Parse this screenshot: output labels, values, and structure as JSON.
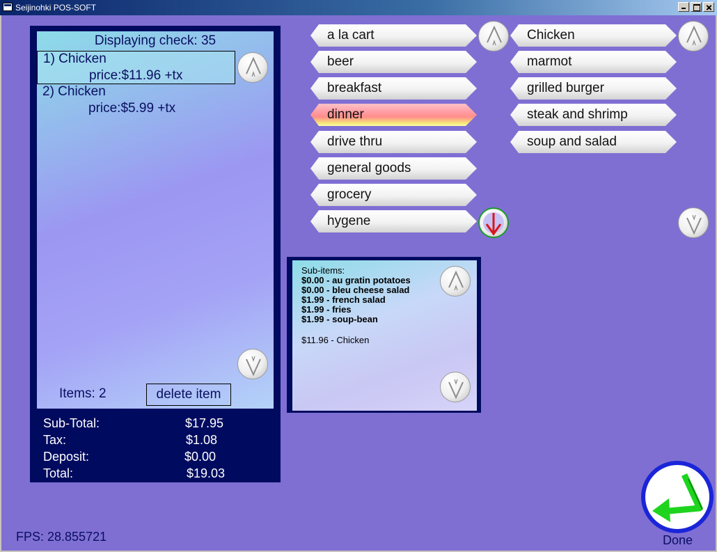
{
  "window": {
    "title": "Seijinohki POS-SOFT"
  },
  "check": {
    "title": "Displaying check: 35",
    "items": [
      {
        "name": "1) Chicken",
        "price": "price:$11.96 +tx"
      },
      {
        "name": "2) Chicken",
        "price": "price:$5.99 +tx"
      }
    ],
    "items_count": "Items: 2",
    "delete_label": "delete item"
  },
  "totals": {
    "subtotal_label": "Sub-Total:",
    "subtotal_value": "$17.95",
    "tax_label": "Tax:",
    "tax_value": "$1.08",
    "deposit_label": "Deposit:",
    "deposit_value": "$0.00",
    "total_label": "Total:",
    "total_value": "$19.03"
  },
  "categories": [
    "a la cart",
    "beer",
    "breakfast",
    "dinner",
    "drive thru",
    "general goods",
    "grocery",
    "hygene"
  ],
  "active_category": "dinner",
  "products": [
    "Chicken",
    "marmot",
    "grilled burger",
    "steak and shrimp",
    "soup and salad"
  ],
  "subitems": {
    "header": "Sub-items:",
    "lines": [
      "$0.00 - au gratin potatoes",
      "$0.00 - bleu cheese salad",
      "$1.99 - french salad",
      "$1.99 - fries",
      "$1.99 - soup-bean"
    ],
    "total_line": "$11.96 - Chicken"
  },
  "status": {
    "fps": "FPS: 28.855721"
  },
  "done_label": "Done",
  "colors": {
    "background": "#7f6fd3",
    "panel": "#000b5f",
    "active_item": "#ff8f8a",
    "done_arrow": "#1ed41e",
    "done_ring": "#1b25d8"
  },
  "icons": {
    "scroll_up": "chevron-up-icon",
    "scroll_down": "chevron-down-icon",
    "scroll_down_active": "red-arrow-down-icon",
    "done": "return-arrow-icon"
  }
}
